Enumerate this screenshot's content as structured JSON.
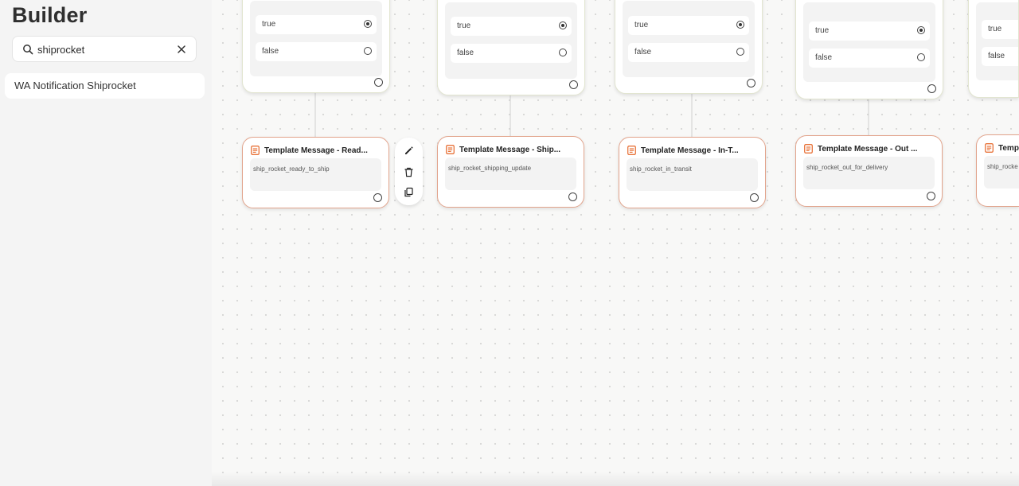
{
  "sidebar": {
    "title": "Builder",
    "search": {
      "value": "shiprocket",
      "placeholder": "Search"
    },
    "results": [
      {
        "label": "WA Notification Shiprocket"
      }
    ]
  },
  "canvas": {
    "condition_nodes": [
      {
        "options": [
          {
            "label": "true",
            "selected": true
          },
          {
            "label": "false",
            "selected": false
          }
        ]
      },
      {
        "options": [
          {
            "label": "true",
            "selected": true
          },
          {
            "label": "false",
            "selected": false
          }
        ]
      },
      {
        "options": [
          {
            "label": "true",
            "selected": true
          },
          {
            "label": "false",
            "selected": false
          }
        ]
      },
      {
        "options": [
          {
            "label": "true",
            "selected": true
          },
          {
            "label": "false",
            "selected": false
          }
        ]
      },
      {
        "options": [
          {
            "label": "true",
            "selected": false
          },
          {
            "label": "false",
            "selected": false
          }
        ]
      }
    ],
    "template_nodes": [
      {
        "title": "Template Message - Read...",
        "template": "ship_rocket_ready_to_ship"
      },
      {
        "title": "Template Message - Ship...",
        "template": "ship_rocket_shipping_update"
      },
      {
        "title": "Template Message - In-T...",
        "template": "ship_rocket_in_transit"
      },
      {
        "title": "Template Message - Out ...",
        "template": "ship_rocket_out_for_delivery"
      },
      {
        "title": "Temp",
        "template": "ship_rocke"
      }
    ]
  },
  "colors": {
    "accent": "#e8743b",
    "template_border": "#e2a48c",
    "condition_border": "#e2e5d0"
  }
}
